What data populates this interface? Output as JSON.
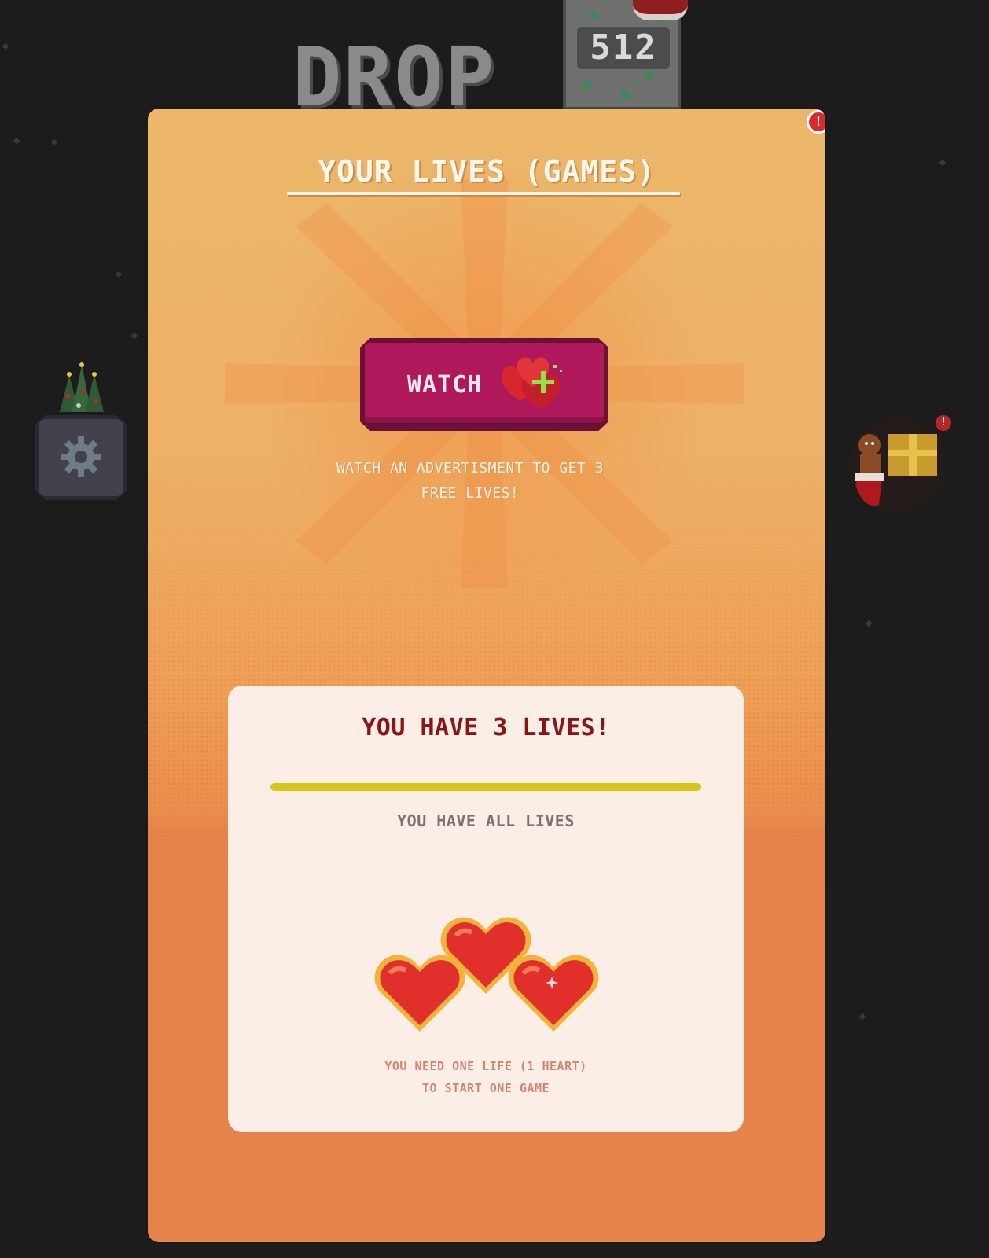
{
  "background": {
    "logo_text": "DROP",
    "score": "512"
  },
  "gift_badge": "!",
  "modal": {
    "title": "YOUR LIVES (GAMES)",
    "alert_badge": "!",
    "watch_button": {
      "label": "WATCH",
      "icon": "hearts-plus-icon"
    },
    "ad_description_line1": "WATCH AN ADVERTISMENT TO GET 3",
    "ad_description_line2": "FREE LIVES!",
    "card": {
      "lives_count_text": "YOU HAVE 3 LIVES!",
      "lives_progress": 1.0,
      "status_text": "YOU HAVE ALL LIVES",
      "hearts": 3,
      "hint_line1": "YOU NEED ONE LIFE (1 HEART)",
      "hint_line2": "TO START ONE GAME"
    }
  },
  "colors": {
    "modal_top": "#ecb76a",
    "modal_bottom": "#e5834b",
    "watch_button": "#b0185c",
    "progress_fill": "#d9c51a",
    "lives_count_text": "#8c1418"
  }
}
